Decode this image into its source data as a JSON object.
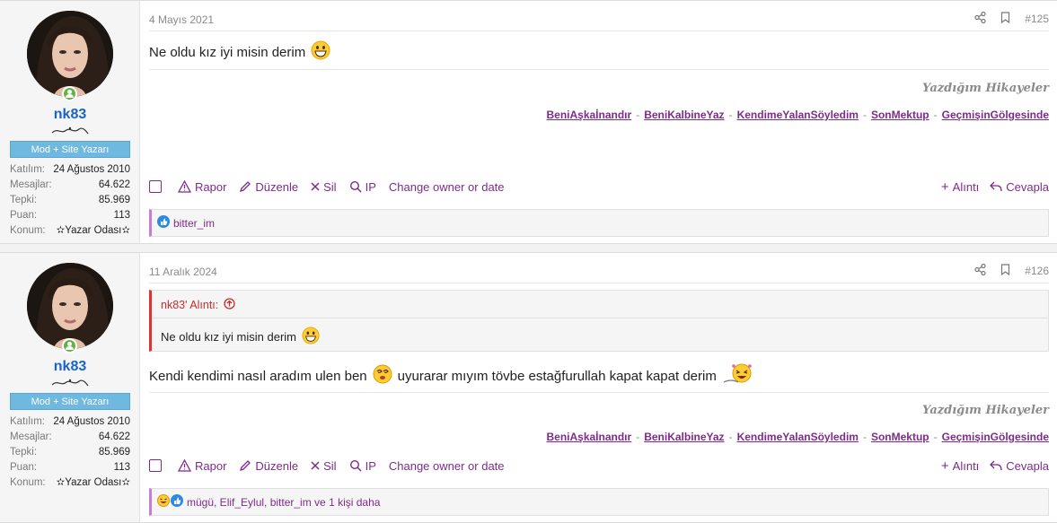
{
  "posts": [
    {
      "date": "4 Mayıs 2021",
      "number": "#125",
      "message": "Ne oldu kız iyi misin derim",
      "reactions": "bitter_im",
      "user": {
        "name": "nk83",
        "title": "Mod + Site Yazarı",
        "stats": [
          {
            "label": "Katılım:",
            "value": "24 Ağustos 2010"
          },
          {
            "label": "Mesajlar:",
            "value": "64.622"
          },
          {
            "label": "Tepki:",
            "value": "85.969"
          },
          {
            "label": "Puan:",
            "value": "113"
          },
          {
            "label": "Konum:",
            "value": "✫Yazar Odası✫"
          }
        ]
      }
    },
    {
      "date": "11 Aralık 2024",
      "number": "#126",
      "quote": {
        "author": "nk83' Alıntı:",
        "text": "Ne oldu kız iyi misin derim"
      },
      "message_a": "Kendi kendimi nasıl aradım ulen ben",
      "message_b": "uyurarar mıyım tövbe estağfurullah kapat kapat derim",
      "reactions": "mügü, Elif_Eylul, bitter_im ve 1 kişi daha",
      "user": {
        "name": "nk83",
        "title": "Mod + Site Yazarı",
        "stats": [
          {
            "label": "Katılım:",
            "value": "24 Ağustos 2010"
          },
          {
            "label": "Mesajlar:",
            "value": "64.622"
          },
          {
            "label": "Tepki:",
            "value": "85.969"
          },
          {
            "label": "Puan:",
            "value": "113"
          },
          {
            "label": "Konum:",
            "value": "✫Yazar Odası✫"
          }
        ]
      }
    }
  ],
  "signature": {
    "title": "Yazdığım Hikayeler",
    "links": [
      "BeniAşkaİnandır",
      "BeniKalbineYaz",
      "KendimeYalanSöyledim",
      "SonMektup",
      "GeçmişinGölgesinde"
    ],
    "separator": "-"
  },
  "actions": {
    "report": "Rapor",
    "edit": "Düzenle",
    "delete": "Sil",
    "ip": "IP",
    "change_owner": "Change owner or date",
    "quote": "Alıntı",
    "reply": "Cevapla"
  },
  "colors": {
    "accent": "#7d2b8b",
    "username": "#1a63c8",
    "quote_border": "#dd3333",
    "title_badge": "#6fb8e0"
  }
}
